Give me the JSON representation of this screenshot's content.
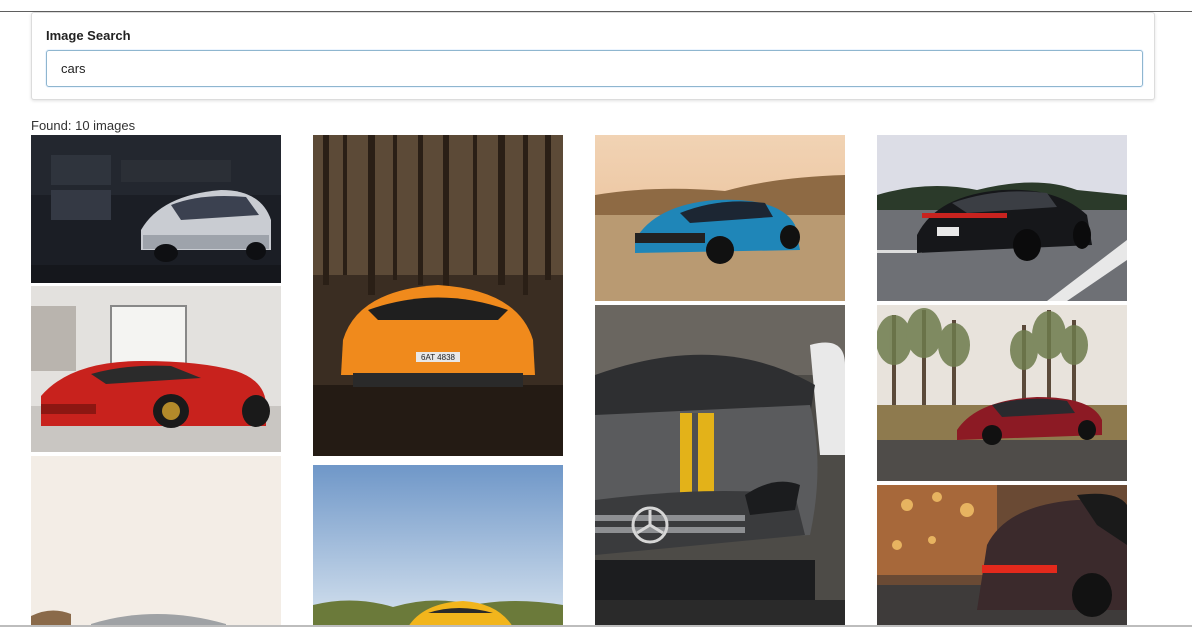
{
  "search": {
    "label": "Image Search",
    "value": "cars",
    "placeholder": ""
  },
  "results": {
    "found_text": "Found: 10 images"
  },
  "images": [
    {
      "name": "white-camaro-garage"
    },
    {
      "name": "red-laferrari-showroom"
    },
    {
      "name": "car-on-cream-background"
    },
    {
      "name": "orange-lamborghini-forest",
      "plate": "6AT 4838"
    },
    {
      "name": "yellow-car-blue-sky"
    },
    {
      "name": "blue-camaro-desert"
    },
    {
      "name": "grey-mercedes-amg-yellow-stripe"
    },
    {
      "name": "black-porsche-panamera-road"
    },
    {
      "name": "red-mercedes-amg-gt-field"
    },
    {
      "name": "red-audi-r8-city-lights"
    }
  ],
  "colors": {
    "input_border": "#8fb6cf",
    "card_border": "#dcdcdc"
  }
}
